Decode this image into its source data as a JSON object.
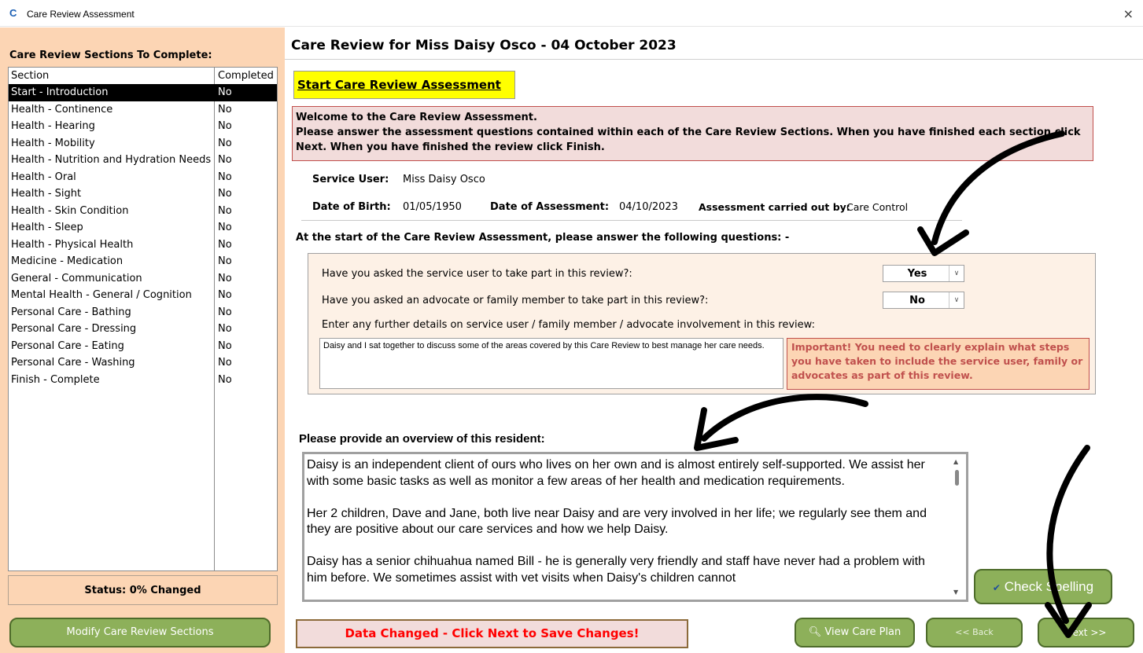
{
  "window": {
    "title": "Care Review Assessment",
    "app_icon": "C",
    "close": "×"
  },
  "sidebar": {
    "heading": "Care Review Sections To Complete:",
    "columns": [
      "Section",
      "Completed"
    ],
    "rows": [
      {
        "section": "Start - Introduction",
        "completed": "No",
        "selected": true
      },
      {
        "section": "Health - Continence",
        "completed": "No"
      },
      {
        "section": "Health - Hearing",
        "completed": "No"
      },
      {
        "section": "Health - Mobility",
        "completed": "No"
      },
      {
        "section": "Health - Nutrition and Hydration Needs",
        "completed": "No"
      },
      {
        "section": "Health - Oral",
        "completed": "No"
      },
      {
        "section": "Health - Sight",
        "completed": "No"
      },
      {
        "section": "Health - Skin Condition",
        "completed": "No"
      },
      {
        "section": "Health - Sleep",
        "completed": "No"
      },
      {
        "section": "Health - Physical Health",
        "completed": "No"
      },
      {
        "section": "Medicine - Medication",
        "completed": "No"
      },
      {
        "section": "General - Communication",
        "completed": "No"
      },
      {
        "section": "Mental Health - General / Cognition",
        "completed": "No"
      },
      {
        "section": "Personal Care - Bathing",
        "completed": "No"
      },
      {
        "section": "Personal Care - Dressing",
        "completed": "No"
      },
      {
        "section": "Personal Care - Eating",
        "completed": "No"
      },
      {
        "section": "Personal Care - Washing",
        "completed": "No"
      },
      {
        "section": "Finish - Complete",
        "completed": "No"
      }
    ],
    "status": "Status: 0% Changed",
    "modify_button": "Modify Care Review Sections"
  },
  "main": {
    "title": "Care Review for Miss Daisy Osco - 04 October 2023",
    "start_heading": "Start Care Review Assessment",
    "welcome_line1": "Welcome to the Care Review Assessment.",
    "welcome_line2": "Please answer the assessment questions contained within each of the Care Review Sections.  When you have finished each section click Next.  When you have finished the review click Finish.",
    "service_user_label": "Service User:",
    "service_user_value": "Miss Daisy Osco",
    "dob_label": "Date of Birth:",
    "dob_value": "01/05/1950",
    "doa_label": "Date of Assessment:",
    "doa_value": "04/10/2023",
    "carried_by_label": "Assessment carried out by:",
    "carried_by_value": "Care Control",
    "intro_question": "At the start of the Care Review Assessment, please answer the following questions: -",
    "q1": "Have you asked the service user to take part in this review?:",
    "q1_value": "Yes",
    "q2": "Have you asked an advocate or family member to take part in this review?:",
    "q2_value": "No",
    "q3": "Enter any further details on service user / family member / advocate involvement  in this review:",
    "details_text": "Daisy and I sat together to discuss some of the areas covered by this Care Review to best manage her care needs.",
    "important_text": "Important!  You need to clearly explain what steps you have taken to include the service user, family or advocates as part of this review.",
    "overview_heading": "Please provide an overview of this resident:",
    "overview_text": "Daisy is an independent client of ours who lives on her own and is almost entirely self-supported. We assist her with some basic tasks as well as monitor a few areas of her health and medication requirements.\n\nHer 2 children, Dave and Jane, both live near Daisy and are very involved in her life; we regularly see them and they are positive about our care services and how we help Daisy.\n\nDaisy has a senior chihuahua named Bill - he is generally very friendly and staff have never had a problem with him before. We sometimes assist with vet visits when Daisy's children cannot",
    "check_spelling": "Check Spelling",
    "data_changed": "Data Changed - Click Next to Save Changes!",
    "view_care_plan": "View Care Plan",
    "back": "<< Back",
    "next": "Next >>"
  },
  "colors": {
    "panel_peach": "#fcd5b4",
    "button_green": "#8db05a",
    "highlight_yellow": "#ffff00",
    "alert_red": "#ff0000",
    "important_text": "#c0504d"
  }
}
